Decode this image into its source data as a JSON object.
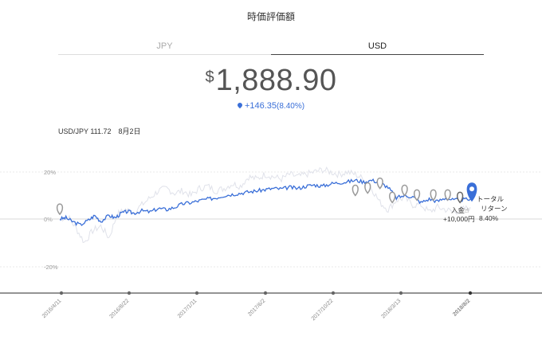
{
  "header": {
    "title": "時価評価額"
  },
  "tabs": [
    {
      "label": "JPY",
      "active": false
    },
    {
      "label": "USD",
      "active": true
    }
  ],
  "valuation": {
    "currency_symbol": "$",
    "amount": "1,888.90"
  },
  "change": {
    "amount": "+146.35",
    "percent": "(8.40%)"
  },
  "fx_rate": "USD/JPY 111.72　8月2日",
  "colors": {
    "primary": "#3a6fd8",
    "benchmark": "#e0e2ea",
    "marker": "#999999"
  },
  "chart_data": {
    "type": "line",
    "x_labels": [
      "2016/4/11",
      "2016/8/22",
      "2017/1/11",
      "2017/6/2",
      "2017/10/22",
      "2018/3/13",
      "2018/8/2"
    ],
    "y_ticks": [
      "20%",
      "0%",
      "-20%"
    ],
    "ylim": [
      -30,
      25
    ],
    "series": [
      {
        "values": [
          [
            0,
            0
          ],
          [
            0.015,
            0.5
          ],
          [
            0.03,
            -1
          ],
          [
            0.05,
            -2.5
          ],
          [
            0.07,
            -0.5
          ],
          [
            0.085,
            1.5
          ],
          [
            0.1,
            -1
          ],
          [
            0.12,
            1.5
          ],
          [
            0.135,
            0.5
          ],
          [
            0.15,
            2.5
          ],
          [
            0.165,
            3.2
          ],
          [
            0.18,
            2.5
          ],
          [
            0.2,
            3.5
          ],
          [
            0.22,
            3
          ],
          [
            0.24,
            4.5
          ],
          [
            0.26,
            4
          ],
          [
            0.28,
            5
          ],
          [
            0.3,
            6.5
          ],
          [
            0.32,
            7
          ],
          [
            0.34,
            7.8
          ],
          [
            0.36,
            8.5
          ],
          [
            0.38,
            9
          ],
          [
            0.4,
            10
          ],
          [
            0.42,
            10.5
          ],
          [
            0.44,
            11
          ],
          [
            0.46,
            11.5
          ],
          [
            0.48,
            12
          ],
          [
            0.5,
            12.5
          ],
          [
            0.52,
            13
          ],
          [
            0.54,
            12.8
          ],
          [
            0.56,
            13.5
          ],
          [
            0.58,
            13
          ],
          [
            0.6,
            14
          ],
          [
            0.62,
            14.5
          ],
          [
            0.64,
            14
          ],
          [
            0.66,
            15
          ],
          [
            0.68,
            15.5
          ],
          [
            0.7,
            15.8
          ],
          [
            0.72,
            16.5
          ],
          [
            0.74,
            15.8
          ],
          [
            0.76,
            16.5
          ],
          [
            0.78,
            15.5
          ],
          [
            0.8,
            13.5
          ],
          [
            0.82,
            9
          ],
          [
            0.84,
            10
          ],
          [
            0.86,
            9.5
          ],
          [
            0.88,
            7
          ],
          [
            0.9,
            8.5
          ],
          [
            0.92,
            7.5
          ],
          [
            0.94,
            9
          ],
          [
            0.96,
            8
          ],
          [
            0.98,
            8.2
          ],
          [
            1.0,
            8.4
          ]
        ]
      },
      {
        "values": [
          [
            0,
            0
          ],
          [
            0.02,
            1
          ],
          [
            0.04,
            -4
          ],
          [
            0.06,
            -10
          ],
          [
            0.08,
            -5
          ],
          [
            0.1,
            -3
          ],
          [
            0.12,
            -8
          ],
          [
            0.14,
            2
          ],
          [
            0.16,
            4
          ],
          [
            0.18,
            3
          ],
          [
            0.2,
            6
          ],
          [
            0.22,
            9
          ],
          [
            0.24,
            12
          ],
          [
            0.26,
            13
          ],
          [
            0.28,
            11
          ],
          [
            0.3,
            12
          ],
          [
            0.32,
            10
          ],
          [
            0.34,
            13
          ],
          [
            0.36,
            14
          ],
          [
            0.38,
            12
          ],
          [
            0.4,
            13
          ],
          [
            0.42,
            15
          ],
          [
            0.44,
            14
          ],
          [
            0.46,
            18
          ],
          [
            0.48,
            17
          ],
          [
            0.5,
            19
          ],
          [
            0.52,
            18
          ],
          [
            0.54,
            17
          ],
          [
            0.56,
            19
          ],
          [
            0.58,
            18
          ],
          [
            0.6,
            19
          ],
          [
            0.62,
            20
          ],
          [
            0.64,
            21
          ],
          [
            0.66,
            20
          ],
          [
            0.68,
            19
          ],
          [
            0.7,
            20
          ],
          [
            0.72,
            19
          ],
          [
            0.74,
            17
          ],
          [
            0.76,
            13
          ],
          [
            0.78,
            7
          ],
          [
            0.8,
            4
          ],
          [
            0.82,
            8
          ],
          [
            0.84,
            9
          ],
          [
            0.86,
            6
          ],
          [
            0.88,
            6
          ],
          [
            0.9,
            3
          ],
          [
            0.92,
            5
          ],
          [
            0.94,
            4
          ],
          [
            0.96,
            3
          ],
          [
            0.98,
            4
          ],
          [
            1.0,
            5
          ]
        ]
      }
    ],
    "events": [
      {
        "x": 0,
        "y": 2
      },
      {
        "x": 0.72,
        "y": 10
      },
      {
        "x": 0.75,
        "y": 11
      },
      {
        "x": 0.78,
        "y": 13
      },
      {
        "x": 0.81,
        "y": 7
      },
      {
        "x": 0.84,
        "y": 10
      },
      {
        "x": 0.87,
        "y": 8
      },
      {
        "x": 0.91,
        "y": 8
      },
      {
        "x": 0.945,
        "y": 8
      },
      {
        "x": 0.975,
        "y": 7
      }
    ],
    "current_marker": {
      "x": 1.0,
      "y": 8.4
    },
    "annotation_deposit": [
      "入金",
      "+10,000円"
    ],
    "annotation_return": [
      "トータル",
      "リターン",
      "8.40%"
    ]
  }
}
